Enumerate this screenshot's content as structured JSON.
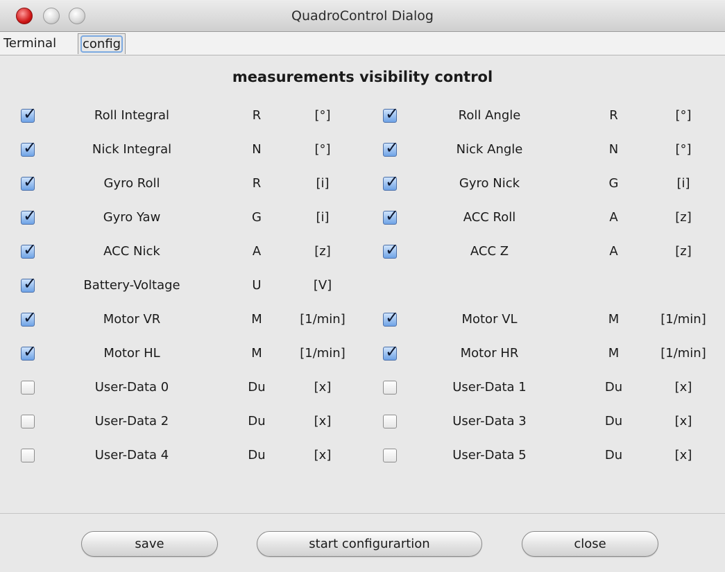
{
  "window": {
    "title": "QuadroControl Dialog"
  },
  "tabs": [
    {
      "label": "Terminal",
      "active": false
    },
    {
      "label": "config",
      "active": true
    }
  ],
  "panel": {
    "heading": "measurements visibility control"
  },
  "rows": [
    {
      "left": {
        "checked": true,
        "name": "Roll Integral",
        "symbol": "R",
        "unit": "[°]"
      },
      "right": {
        "checked": true,
        "name": "Roll Angle",
        "symbol": "R",
        "unit": "[°]"
      }
    },
    {
      "left": {
        "checked": true,
        "name": "Nick Integral",
        "symbol": "N",
        "unit": "[°]"
      },
      "right": {
        "checked": true,
        "name": "Nick Angle",
        "symbol": "N",
        "unit": "[°]"
      }
    },
    {
      "left": {
        "checked": true,
        "name": "Gyro Roll",
        "symbol": "R",
        "unit": "[i]"
      },
      "right": {
        "checked": true,
        "name": "Gyro Nick",
        "symbol": "G",
        "unit": "[i]"
      }
    },
    {
      "left": {
        "checked": true,
        "name": "Gyro Yaw",
        "symbol": "G",
        "unit": "[i]"
      },
      "right": {
        "checked": true,
        "name": "ACC Roll",
        "symbol": "A",
        "unit": "[z]"
      }
    },
    {
      "left": {
        "checked": true,
        "name": "ACC Nick",
        "symbol": "A",
        "unit": "[z]"
      },
      "right": {
        "checked": true,
        "name": "ACC Z",
        "symbol": "A",
        "unit": "[z]"
      }
    },
    {
      "left": {
        "checked": true,
        "name": "Battery-Voltage",
        "symbol": "U",
        "unit": "[V]"
      },
      "right": null
    },
    {
      "left": {
        "checked": true,
        "name": "Motor VR",
        "symbol": "M",
        "unit": "[1/min]"
      },
      "right": {
        "checked": true,
        "name": "Motor VL",
        "symbol": "M",
        "unit": "[1/min]"
      }
    },
    {
      "left": {
        "checked": true,
        "name": "Motor HL",
        "symbol": "M",
        "unit": "[1/min]"
      },
      "right": {
        "checked": true,
        "name": "Motor HR",
        "symbol": "M",
        "unit": "[1/min]"
      }
    },
    {
      "left": {
        "checked": false,
        "name": "User-Data 0",
        "symbol": "Du",
        "unit": "[x]"
      },
      "right": {
        "checked": false,
        "name": "User-Data 1",
        "symbol": "Du",
        "unit": "[x]"
      }
    },
    {
      "left": {
        "checked": false,
        "name": "User-Data 2",
        "symbol": "Du",
        "unit": "[x]"
      },
      "right": {
        "checked": false,
        "name": "User-Data 3",
        "symbol": "Du",
        "unit": "[x]"
      }
    },
    {
      "left": {
        "checked": false,
        "name": "User-Data 4",
        "symbol": "Du",
        "unit": "[x]"
      },
      "right": {
        "checked": false,
        "name": "User-Data 5",
        "symbol": "Du",
        "unit": "[x]"
      }
    }
  ],
  "buttons": {
    "save": "save",
    "start_configuration": "start configurartion",
    "close": "close"
  },
  "colors": {
    "accent": "#6fa3e6",
    "close_light": "#d01818",
    "window_bg": "#e8e8e8"
  }
}
